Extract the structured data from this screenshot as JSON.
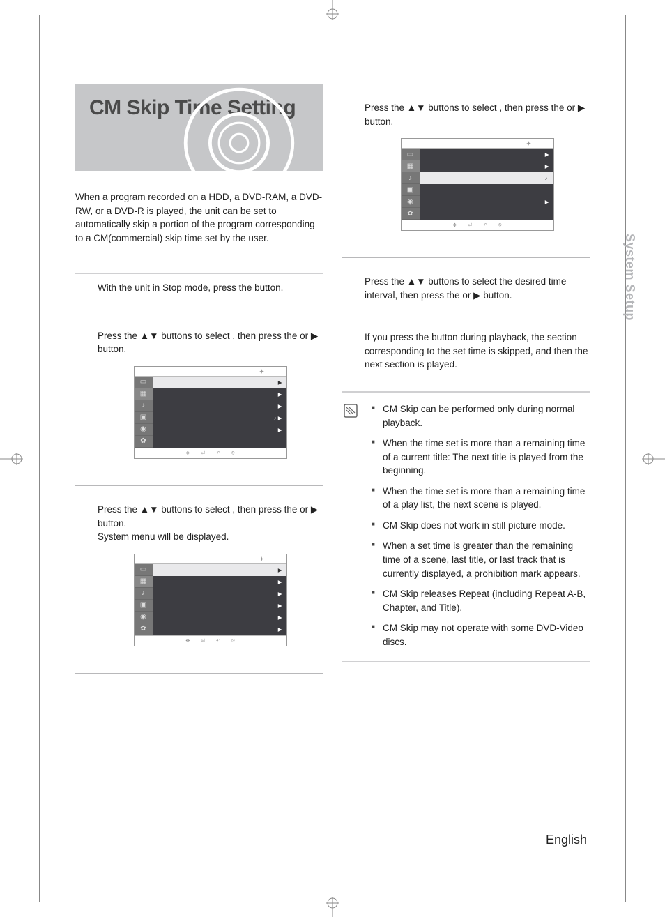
{
  "title": "CM Skip Time Setting",
  "intro": "When a program recorded on a HDD, a DVD-RAM, a DVD-RW, or a DVD-R is played, the unit can be set to automatically skip a portion of the program corresponding to a CM(commercial) skip time set by the user.",
  "section_tab": "System Setup",
  "footer_lang": "English",
  "glyphs": {
    "up_down": "▲▼",
    "right": "▶"
  },
  "steps": {
    "s1": {
      "text_before": "With the unit in Stop mode, press the ",
      "button_label": "",
      "text_after": " button."
    },
    "s2": {
      "text_a": "Press the ",
      "text_b": " buttons to select ",
      "select_label": "",
      "text_c": ", then press the ",
      "enter_label": "",
      "text_d": " or ",
      "text_e": " button."
    },
    "s3": {
      "text_a": "Press the ",
      "text_b": " buttons to select ",
      "select_label": "",
      "text_c": ", then press the ",
      "enter_label": "",
      "text_d": " or ",
      "text_e": " button.",
      "extra": "System menu will be displayed."
    },
    "s4": {
      "text_a": "Press the  ",
      "text_b": " buttons to select ",
      "select_label": "",
      "text_c": ", then press the ",
      "enter_label": "",
      "text_d": " or ",
      "text_e": " button."
    },
    "s5": {
      "text_a": "Press the ",
      "text_b": " buttons to select the desired time interval, then press the ",
      "enter_label": "",
      "text_c": " or ",
      "text_d": " button."
    },
    "s6": {
      "text_a": "If you press the ",
      "button_label": "",
      "text_b": " button during playback, the section corresponding to the set time is skipped, and then the next section is played."
    }
  },
  "osd_screens": {
    "common": {
      "side_icons": [
        "rec-icon",
        "movie-icon",
        "music-icon",
        "photo-icon",
        "disc-icon",
        "settings-icon"
      ],
      "foot": [
        "move-icon",
        "enter-icon",
        "return-icon",
        "exit-icon"
      ]
    }
  },
  "notes": [
    "CM Skip can be performed only during normal playback.",
    "When the time set is more than a remaining time of a current title: The next title is played from the beginning.",
    "When the time set is more than a remaining time of a play list, the next scene is played.",
    "CM Skip does not work in still picture mode.",
    "When a set time is greater than the remaining time of a scene, last title, or last track that is currently displayed, a prohibition mark appears.",
    "CM Skip releases Repeat (including Repeat A-B, Chapter, and Title).",
    "CM Skip may not operate with some DVD-Video discs."
  ]
}
